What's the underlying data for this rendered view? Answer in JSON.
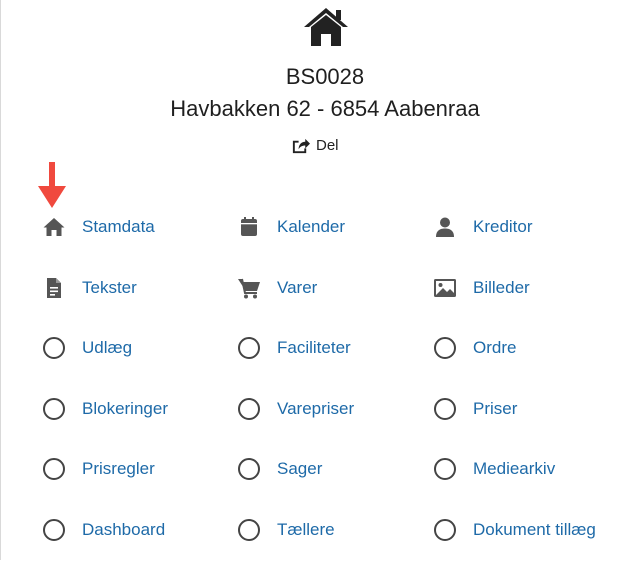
{
  "property": {
    "code": "BS0028",
    "address": "Havbakken 62 - 6854 Aabenraa",
    "share_label": "Del"
  },
  "colors": {
    "link": "#1e6aa8",
    "icon": "#555555",
    "arrow": "#f0493e"
  },
  "menu": [
    {
      "label": "Stamdata",
      "icon": "home-icon"
    },
    {
      "label": "Kalender",
      "icon": "calendar-icon"
    },
    {
      "label": "Kreditor",
      "icon": "user-icon"
    },
    {
      "label": "Tekster",
      "icon": "document-icon"
    },
    {
      "label": "Varer",
      "icon": "cart-icon"
    },
    {
      "label": "Billeder",
      "icon": "image-icon"
    },
    {
      "label": "Udlæg",
      "icon": "radio-icon"
    },
    {
      "label": "Faciliteter",
      "icon": "radio-icon"
    },
    {
      "label": "Ordre",
      "icon": "radio-icon"
    },
    {
      "label": "Blokeringer",
      "icon": "radio-icon"
    },
    {
      "label": "Varepriser",
      "icon": "radio-icon"
    },
    {
      "label": "Priser",
      "icon": "radio-icon"
    },
    {
      "label": "Prisregler",
      "icon": "radio-icon"
    },
    {
      "label": "Sager",
      "icon": "radio-icon"
    },
    {
      "label": "Mediearkiv",
      "icon": "radio-icon"
    },
    {
      "label": "Dashboard",
      "icon": "radio-icon"
    },
    {
      "label": "Tællere",
      "icon": "radio-icon"
    },
    {
      "label": "Dokument tillæg",
      "icon": "radio-icon"
    }
  ]
}
